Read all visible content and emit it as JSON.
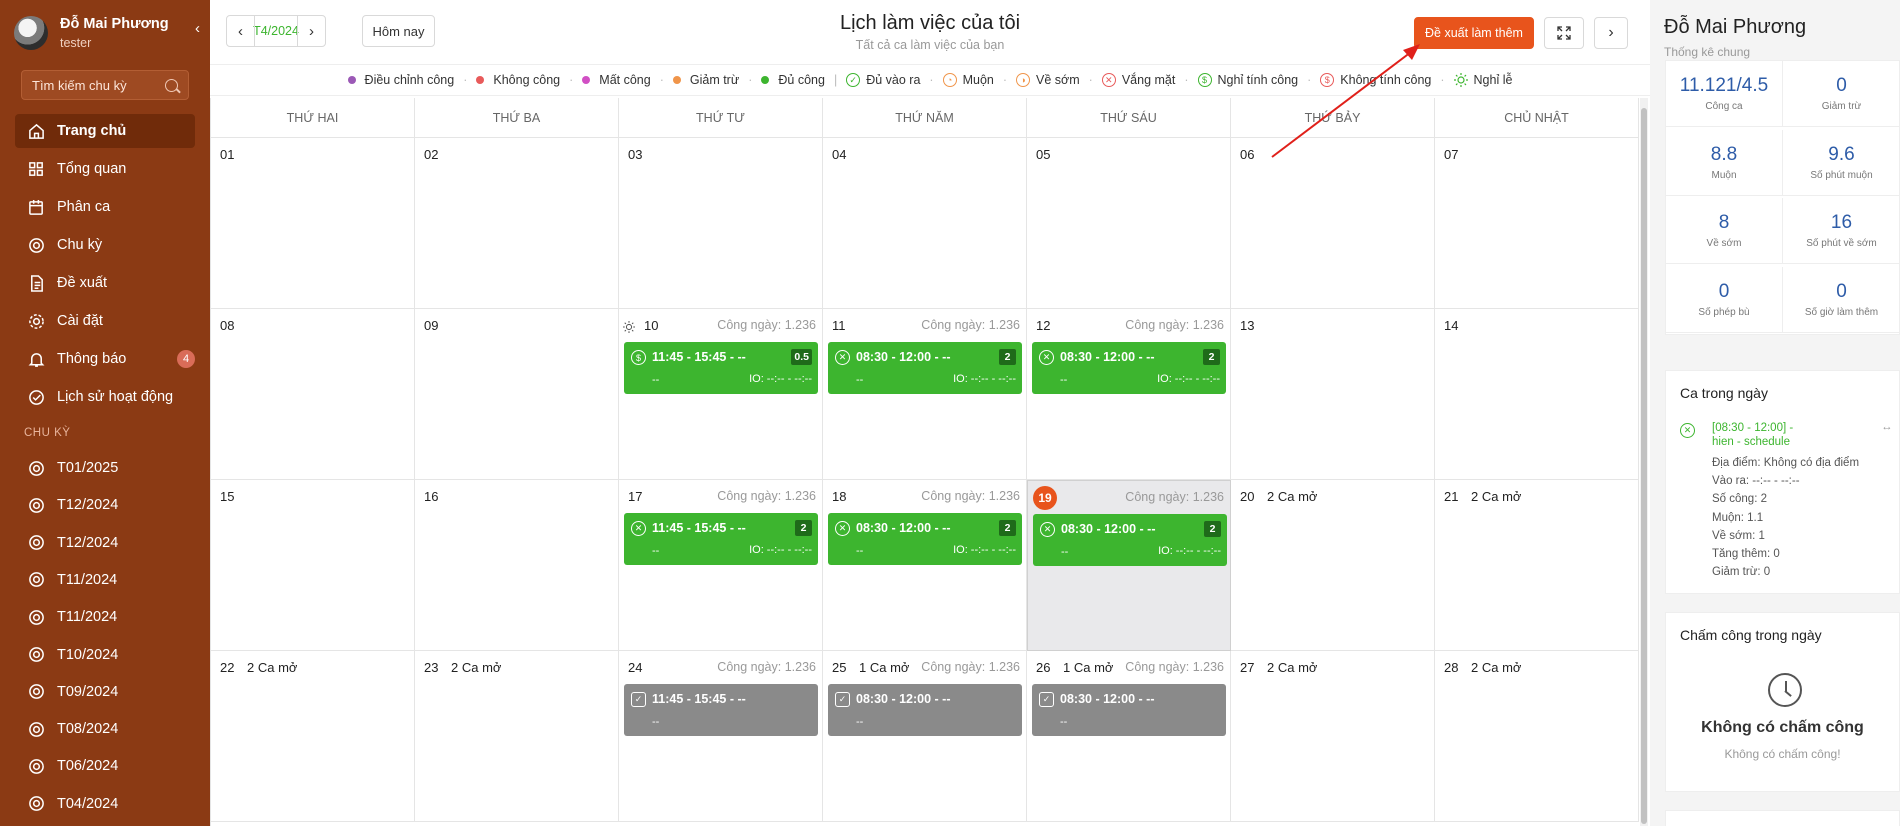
{
  "sidebar": {
    "user_name": "Đỗ Mai Phương",
    "user_role": "tester",
    "collapse_icon": "‹",
    "search_placeholder": "Tìm kiếm chu kỳ",
    "nav": [
      {
        "label": "Trang chủ",
        "icon": "home-icon",
        "active": true
      },
      {
        "label": "Tổng quan",
        "icon": "grid-icon"
      },
      {
        "label": "Phân ca",
        "icon": "calendar-edit-icon"
      },
      {
        "label": "Chu kỳ",
        "icon": "cycle-icon"
      },
      {
        "label": "Đề xuất",
        "icon": "document-icon"
      },
      {
        "label": "Cài đặt",
        "icon": "gear-icon"
      },
      {
        "label": "Thông báo",
        "icon": "bell-icon",
        "badge": "4"
      },
      {
        "label": "Lịch sử hoạt động",
        "icon": "check-circle-icon"
      }
    ],
    "section_label": "CHU KỲ",
    "cycles": [
      "T01/2025",
      "T12/2024",
      "T12/2024",
      "T11/2024",
      "T11/2024",
      "T10/2024",
      "T09/2024",
      "T08/2024",
      "T06/2024",
      "T04/2024"
    ]
  },
  "topbar": {
    "month": "T4/2024",
    "today_label": "Hôm nay",
    "title": "Lịch làm việc của tôi",
    "subtitle": "Tất cả ca làm việc của bạn",
    "propose_label": "Đề xuất làm thêm"
  },
  "legend": [
    {
      "label": "Điều chỉnh công",
      "kind": "dot",
      "color": "#9b59b6"
    },
    {
      "label": "Không công",
      "kind": "dot",
      "color": "#e85a5a"
    },
    {
      "label": "Mất công",
      "kind": "dot",
      "color": "#d14fc4"
    },
    {
      "label": "Giảm trừ",
      "kind": "dot",
      "color": "#f0954a"
    },
    {
      "label": "Đủ công",
      "kind": "dot",
      "color": "#3db52f"
    },
    {
      "label": "Đủ vào ra",
      "kind": "icon",
      "color": "#3db52f",
      "glyph": "✓"
    },
    {
      "label": "Muộn",
      "kind": "icon",
      "color": "#f0954a",
      "glyph": "◔"
    },
    {
      "label": "Về sớm",
      "kind": "icon",
      "color": "#f0954a",
      "glyph": "◑"
    },
    {
      "label": "Vắng mặt",
      "kind": "icon",
      "color": "#e85a5a",
      "glyph": "✕"
    },
    {
      "label": "Nghỉ tính công",
      "kind": "icon",
      "color": "#3db52f",
      "glyph": "$"
    },
    {
      "label": "Không tính công",
      "kind": "icon",
      "color": "#e85a5a",
      "glyph": "$"
    },
    {
      "label": "Nghỉ lễ",
      "kind": "sun",
      "color": "#3db52f"
    }
  ],
  "weekdays": [
    "THỨ HAI",
    "THỨ BA",
    "THỨ TƯ",
    "THỨ NĂM",
    "THỨ SÁU",
    "THỨ BẢY",
    "CHỦ NHẬT"
  ],
  "cong_prefix": "Công ngày: ",
  "weeks": [
    [
      {
        "day": "01"
      },
      {
        "day": "02"
      },
      {
        "day": "03"
      },
      {
        "day": "04"
      },
      {
        "day": "05"
      },
      {
        "day": "06"
      },
      {
        "day": "07"
      }
    ],
    [
      {
        "day": "08"
      },
      {
        "day": "09"
      },
      {
        "day": "10",
        "sun": true,
        "cong": "1.236",
        "shift": {
          "color": "green",
          "icon": "$",
          "time": "11:45 - 15:45 - --",
          "badge": "0.5",
          "sub": "--",
          "io": "IO: --:-- - --:--"
        }
      },
      {
        "day": "11",
        "cong": "1.236",
        "shift": {
          "color": "green",
          "icon": "✕",
          "time": "08:30 - 12:00 - --",
          "badge": "2",
          "sub": "--",
          "io": "IO: --:-- - --:--"
        }
      },
      {
        "day": "12",
        "cong": "1.236",
        "shift": {
          "color": "green",
          "icon": "✕",
          "time": "08:30 - 12:00 - --",
          "badge": "2",
          "sub": "--",
          "io": "IO: --:-- - --:--"
        }
      },
      {
        "day": "13"
      },
      {
        "day": "14"
      }
    ],
    [
      {
        "day": "15"
      },
      {
        "day": "16"
      },
      {
        "day": "17",
        "cong": "1.236",
        "shift": {
          "color": "green",
          "icon": "✕",
          "time": "11:45 - 15:45 - --",
          "badge": "2",
          "sub": "--",
          "io": "IO: --:-- - --:--"
        }
      },
      {
        "day": "18",
        "cong": "1.236",
        "shift": {
          "color": "green",
          "icon": "✕",
          "time": "08:30 - 12:00 - --",
          "badge": "2",
          "sub": "--",
          "io": "IO: --:-- - --:--"
        }
      },
      {
        "day": "19",
        "today": true,
        "cong": "1.236",
        "shift": {
          "color": "green",
          "icon": "✕",
          "time": "08:30 - 12:00 - --",
          "badge": "2",
          "sub": "--",
          "io": "IO: --:-- - --:--"
        }
      },
      {
        "day": "20",
        "open": "2 Ca mở"
      },
      {
        "day": "21",
        "open": "2 Ca mở"
      }
    ],
    [
      {
        "day": "22",
        "open": "2 Ca mở"
      },
      {
        "day": "23",
        "open": "2 Ca mở"
      },
      {
        "day": "24",
        "cong": "1.236",
        "shift": {
          "color": "gray",
          "icon": "✓",
          "time": "11:45 - 15:45 - --",
          "sub": "--"
        }
      },
      {
        "day": "25",
        "open": "1 Ca mở",
        "cong": "1.236",
        "shift": {
          "color": "gray",
          "icon": "✓",
          "time": "08:30 - 12:00 - --",
          "sub": "--"
        }
      },
      {
        "day": "26",
        "open": "1 Ca mở",
        "cong": "1.236",
        "shift": {
          "color": "gray",
          "icon": "✓",
          "time": "08:30 - 12:00 - --",
          "sub": "--"
        }
      },
      {
        "day": "27",
        "open": "2 Ca mở"
      },
      {
        "day": "28",
        "open": "2 Ca mở"
      }
    ]
  ],
  "right": {
    "name": "Đỗ Mai Phương",
    "subtitle": "Thống kê chung",
    "stats": [
      {
        "value": "11.121/4.5",
        "label": "Công ca"
      },
      {
        "value": "0",
        "label": "Giảm trừ"
      },
      {
        "value": "8.8",
        "label": "Muộn"
      },
      {
        "value": "9.6",
        "label": "Số phút muộn"
      },
      {
        "value": "8",
        "label": "Về sớm"
      },
      {
        "value": "16",
        "label": "Số phút về sớm"
      },
      {
        "value": "0",
        "label": "Số phép bù"
      },
      {
        "value": "0",
        "label": "Số giờ làm thêm"
      }
    ],
    "shift_card": {
      "title": "Ca trong ngày",
      "line1": "[08:30 - 12:00] -",
      "line2": "hien - schedule",
      "more": "↔",
      "lines": [
        "Địa điểm: Không có địa điểm",
        "Vào ra: --:-- - --:--",
        "Số công: 2",
        "Muộn: 1.1",
        "Về sớm: 1",
        "Tăng thêm: 0",
        "Giảm trừ: 0"
      ]
    },
    "checkin_card": {
      "title": "Chấm công trong ngày",
      "empty_title": "Không có chấm công",
      "empty_sub": "Không có chấm công!"
    }
  },
  "colors": {
    "sidebar": "#8b3a14",
    "accent": "#e8541c",
    "green": "#3db52f",
    "gray": "#8a8a8a",
    "stat_value": "#2e5ca8"
  }
}
